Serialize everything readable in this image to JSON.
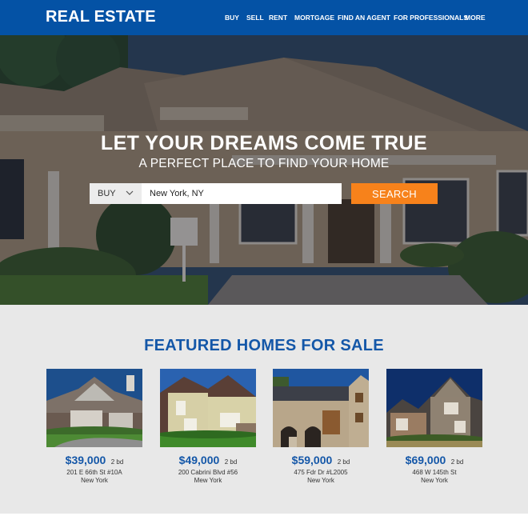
{
  "header": {
    "logo": "REAL ESTATE",
    "nav": [
      {
        "label": "BUY"
      },
      {
        "label": "SELL"
      },
      {
        "label": "RENT"
      },
      {
        "label": "MORTGAGE"
      },
      {
        "label": "FIND AN AGENT"
      },
      {
        "label": "FOR PROFESSIONALS"
      },
      {
        "label": "MORE"
      }
    ]
  },
  "hero": {
    "title": "LET YOUR DREAMS COME TRUE",
    "subtitle": "A PERFECT PLACE TO FIND YOUR HOME",
    "search": {
      "type_selected": "BUY",
      "location_value": "New York, NY",
      "button_label": "SEARCH"
    }
  },
  "featured": {
    "title": "FEATURED HOMES FOR SALE",
    "listings": [
      {
        "price": "$39,000",
        "beds": "2 bd",
        "address": "201 E 66th St #10A",
        "city": "New York"
      },
      {
        "price": "$49,000",
        "beds": "2 bd",
        "address": "200 Cabrini Blvd #56",
        "city": "Mew York"
      },
      {
        "price": "$59,000",
        "beds": "2 bd",
        "address": "475 Fdr Dr #L2005",
        "city": "New York"
      },
      {
        "price": "$69,000",
        "beds": "2 bd",
        "address": "468 W 145th St",
        "city": "New York"
      }
    ]
  },
  "colors": {
    "header_bg": "#0452a5",
    "accent_orange": "#f7821b",
    "heading_blue": "#1457a8",
    "section_bg": "#e8e8e8"
  }
}
